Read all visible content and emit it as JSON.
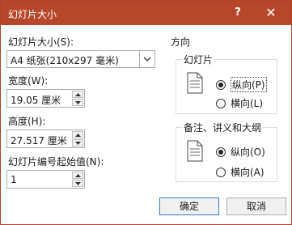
{
  "window": {
    "title": "幻灯片大小",
    "help_label": "?",
    "close_label": "✕"
  },
  "slide_size": {
    "label": "幻灯片大小(S):",
    "selected": "A4 纸张(210x297 毫米)"
  },
  "width": {
    "label": "宽度(W):",
    "value": "19.05 厘米"
  },
  "height": {
    "label": "高度(H):",
    "value": "27.517 厘米"
  },
  "start_number": {
    "label": "幻灯片编号起始值(N):",
    "value": "1"
  },
  "orientation": {
    "label": "方向",
    "slides": {
      "label": "幻灯片",
      "portrait_label": "纵向(P)",
      "landscape_label": "横向(L)",
      "selected": "portrait"
    },
    "notes": {
      "label": "备注、讲义和大纲",
      "portrait_label": "纵向(O)",
      "landscape_label": "横向(A)",
      "selected": "portrait"
    }
  },
  "buttons": {
    "ok_label": "确定",
    "cancel_label": "取消"
  },
  "colors": {
    "titlebar": "#b7472a",
    "focus_border": "#3a78c8"
  }
}
